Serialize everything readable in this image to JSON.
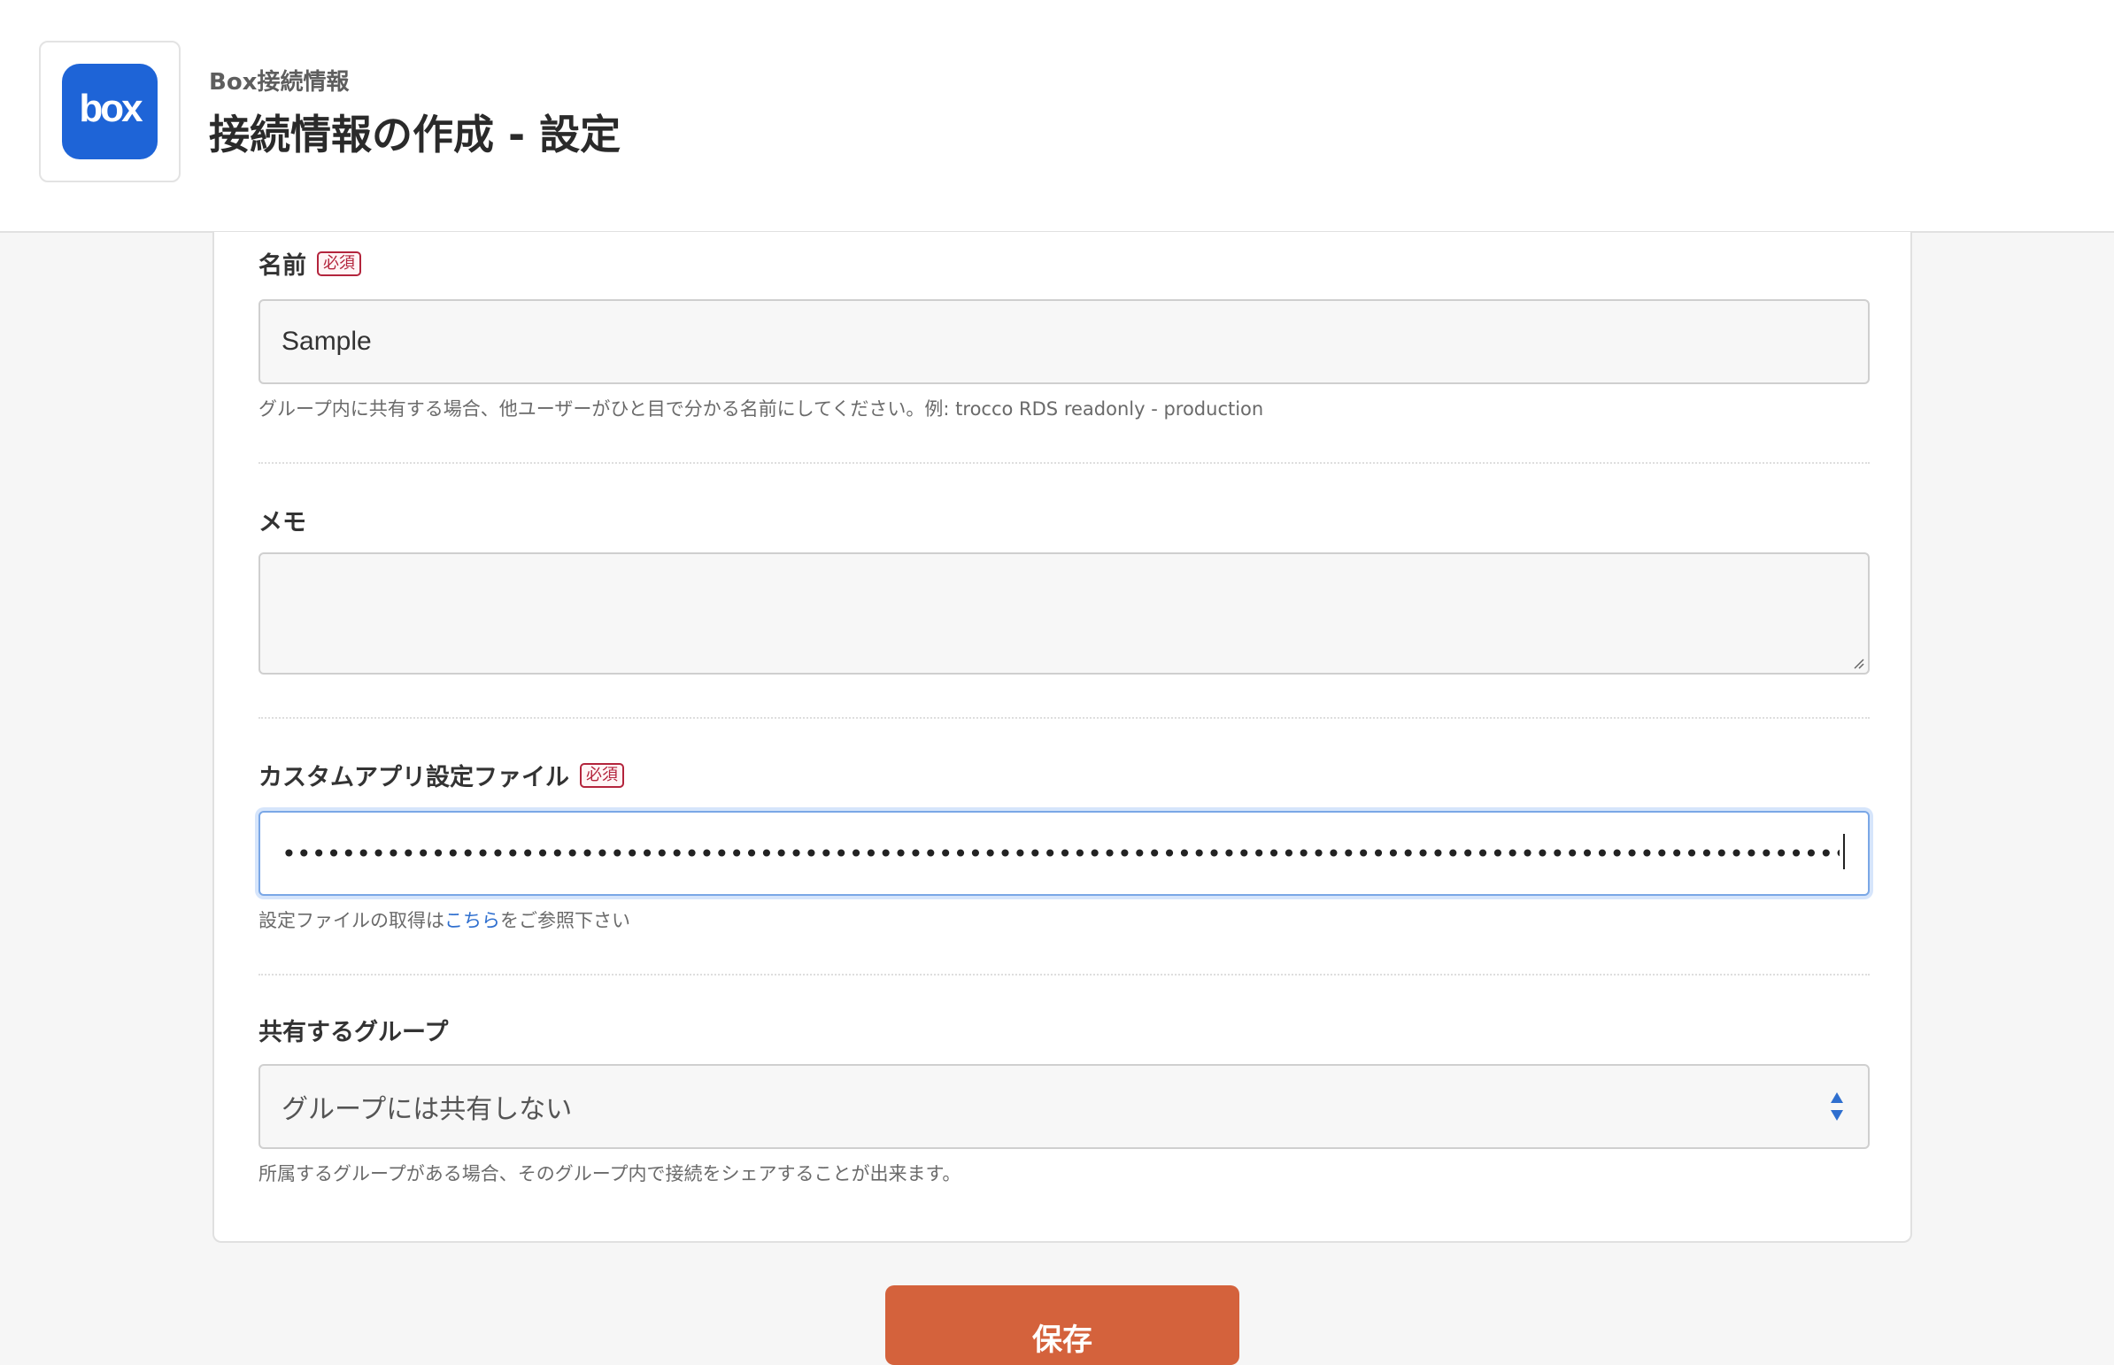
{
  "header": {
    "logo_text": "box",
    "breadcrumb": "Box接続情報",
    "title": "接続情報の作成 - 設定"
  },
  "form": {
    "name": {
      "label": "名前",
      "required_badge": "必須",
      "value": "Sample",
      "help": "グループ内に共有する場合、他ユーザーがひと目で分かる名前にしてください。例: trocco RDS readonly - production"
    },
    "memo": {
      "label": "メモ",
      "value": ""
    },
    "custom_app_file": {
      "label": "カスタムアプリ設定ファイル",
      "required_badge": "必須",
      "masked_value": "••••••••••••••••••••••••••••••••••••••••••••••••••••••••••••••••••••••••••••••••••••••••••••••••••••••••••••••••••••••••••••••••••••••••",
      "help_prefix": "設定ファイルの取得は",
      "help_link": "こちら",
      "help_suffix": "をご参照下さい"
    },
    "share_group": {
      "label": "共有するグループ",
      "selected": "グループには共有しない",
      "help": "所属するグループがある場合、そのグループ内で接続をシェアすることが出来ます。"
    }
  },
  "actions": {
    "save_label": "保存"
  },
  "colors": {
    "brand_box": "#1e64d7",
    "required": "#b3243c",
    "link": "#2f6fcf",
    "save": "#d4623c"
  }
}
